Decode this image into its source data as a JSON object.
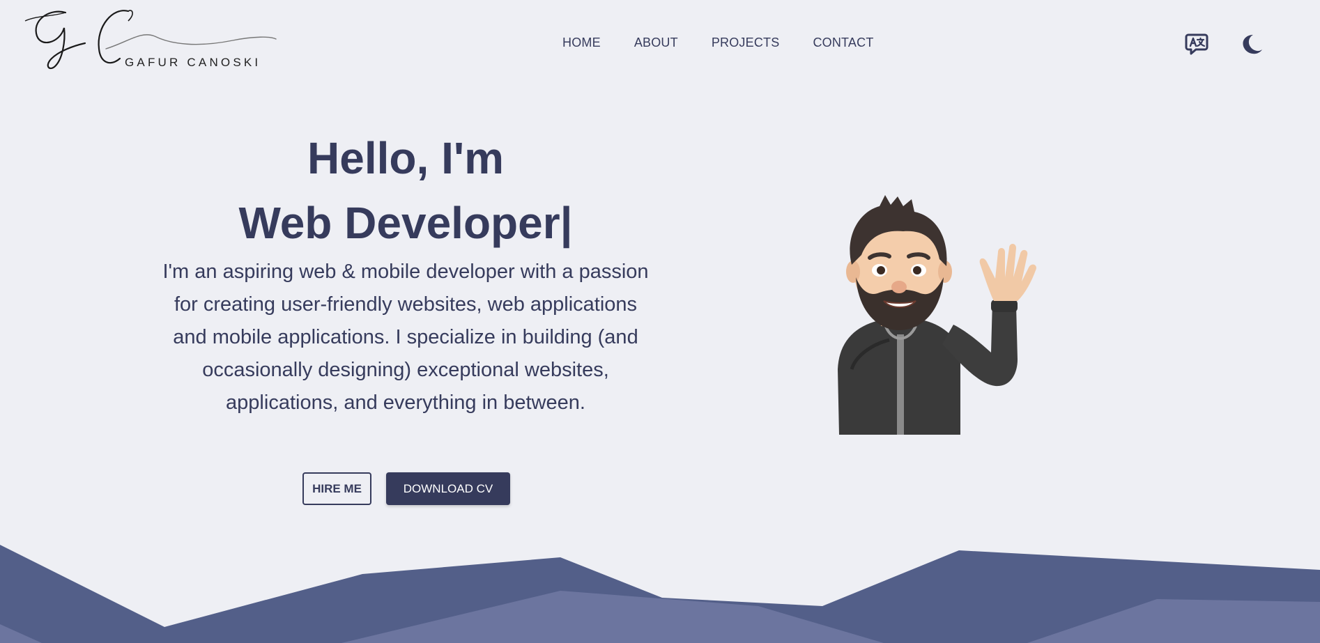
{
  "header": {
    "logo_initials": "GC",
    "logo_text": "GAFUR CANOSKI",
    "nav": [
      {
        "label": "HOME"
      },
      {
        "label": "ABOUT"
      },
      {
        "label": "PROJECTS"
      },
      {
        "label": "CONTACT"
      }
    ],
    "icons": [
      "translate-icon",
      "moon-icon"
    ]
  },
  "hero": {
    "greeting": "Hello, I'm",
    "role": "Web Developer|",
    "intro": "I'm an aspiring web & mobile developer with a passion for creating user-friendly websites, web applications and mobile applications. I specialize in building (and occasionally designing) exceptional websites, applications, and everything in between.",
    "hire_label": "HIRE ME",
    "cv_label": "DOWNLOAD CV"
  },
  "colors": {
    "background": "#eeeff4",
    "primary": "#363b5c",
    "mountain_dark": "#535f89",
    "mountain_light": "#6c759f"
  }
}
